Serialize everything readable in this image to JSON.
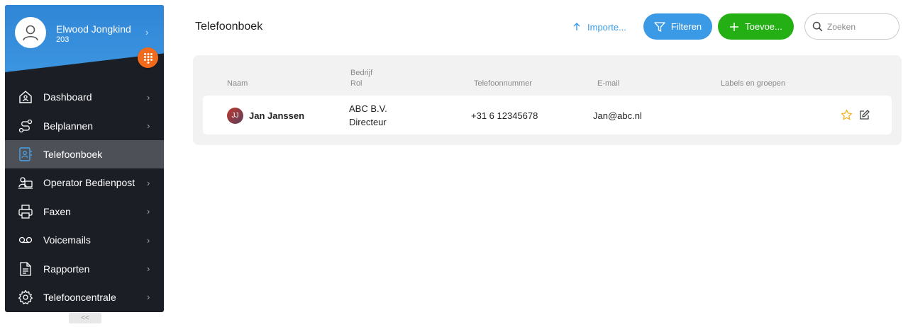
{
  "user": {
    "name": "Elwood Jongkind",
    "extension": "203"
  },
  "nav": {
    "items": [
      {
        "label": "Dashboard",
        "icon": "house-icon",
        "active": false,
        "has_chevron": true
      },
      {
        "label": "Belplannen",
        "icon": "route-icon",
        "active": false,
        "has_chevron": true
      },
      {
        "label": "Telefoonboek",
        "icon": "contact-book-icon",
        "active": true,
        "has_chevron": false
      },
      {
        "label": "Operator Bedienpost",
        "icon": "operator-icon",
        "active": false,
        "has_chevron": true
      },
      {
        "label": "Faxen",
        "icon": "printer-icon",
        "active": false,
        "has_chevron": true
      },
      {
        "label": "Voicemails",
        "icon": "voicemail-icon",
        "active": false,
        "has_chevron": true
      },
      {
        "label": "Rapporten",
        "icon": "document-icon",
        "active": false,
        "has_chevron": true
      },
      {
        "label": "Telefooncentrale",
        "icon": "gear-icon",
        "active": false,
        "has_chevron": true
      }
    ],
    "collapse_label": "<<"
  },
  "header": {
    "title": "Telefoonboek",
    "import_label": "Importe...",
    "filter_label": "Filteren",
    "add_label": "Toevoe...",
    "search_placeholder": "Zoeken"
  },
  "table": {
    "columns": {
      "naam": "Naam",
      "bedrijf": "Bedrijf",
      "rol": "Rol",
      "telefoon": "Telefoonnummer",
      "email": "E-mail",
      "labels": "Labels en groepen"
    },
    "rows": [
      {
        "initials": "JJ",
        "name": "Jan Janssen",
        "company": "ABC B.V.",
        "role": "Directeur",
        "phone": "+31 6 12345678",
        "email": "Jan@abc.nl",
        "labels": ""
      }
    ]
  },
  "colors": {
    "sidebar_bg": "#1b1f25",
    "header_blue": "#2f86d6",
    "accent_blue": "#3a9ae6",
    "accent_green": "#24b014",
    "dialpad_orange": "#f26b1d",
    "star_yellow": "#f0b429"
  }
}
